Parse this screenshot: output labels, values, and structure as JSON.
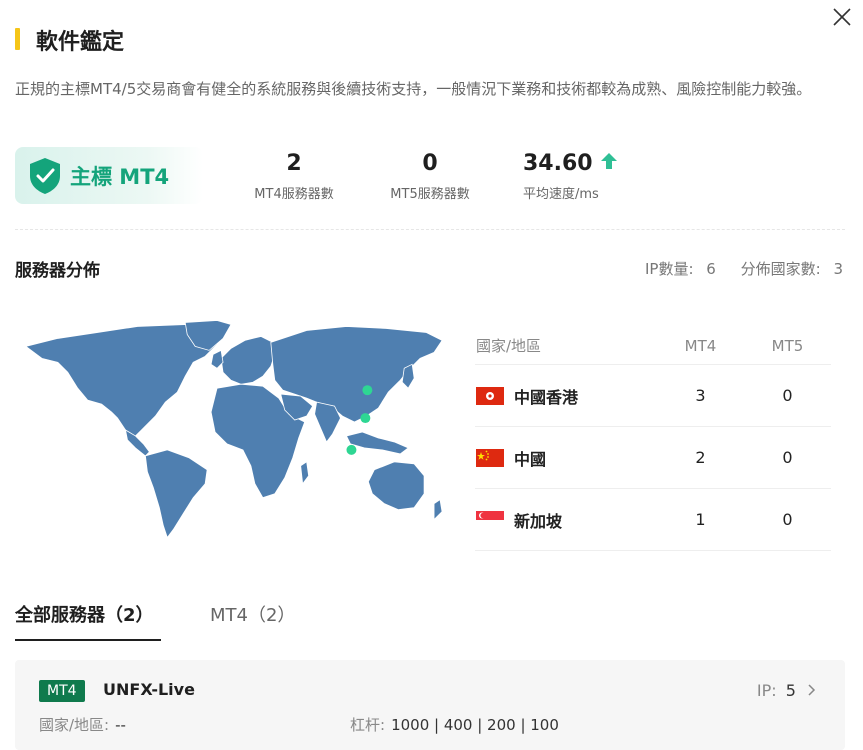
{
  "header": {
    "title": "軟件鑑定"
  },
  "description": "正規的主標MT4/5交易商會有健全的系統服務與後續技術支持，一般情況下業務和技術都較為成熟、風險控制能力較強。",
  "badge": {
    "label": "主標 MT4"
  },
  "stats": [
    {
      "value": "2",
      "label": "MT4服務器數"
    },
    {
      "value": "0",
      "label": "MT5服務器數"
    },
    {
      "value": "34.60",
      "label": "平均速度/ms"
    }
  ],
  "distribution": {
    "title": "服務器分佈",
    "ip_label": "IP數量:",
    "ip_count": "6",
    "country_label": "分佈國家數:",
    "country_count": "3",
    "table": {
      "headers": [
        "國家/地區",
        "MT4",
        "MT5"
      ],
      "rows": [
        {
          "country": "中國香港",
          "mt4": "3",
          "mt5": "0"
        },
        {
          "country": "中國",
          "mt4": "2",
          "mt5": "0"
        },
        {
          "country": "新加坡",
          "mt4": "1",
          "mt5": "0"
        }
      ]
    },
    "colors": {
      "map": "#4f7fb0",
      "marker": "#2ed693"
    }
  },
  "tabs": [
    {
      "label": "全部服務器（2）",
      "active": true
    },
    {
      "label": "MT4（2）",
      "active": false
    }
  ],
  "server_card": {
    "tag": "MT4",
    "name": "UNFX-Live",
    "ip_label": "IP:",
    "ip_count": "5",
    "country_label": "國家/地區:",
    "country_value": "--",
    "leverage_label": "杠杆:",
    "leverage_value": "1000 | 400 | 200 | 100"
  },
  "icons": {
    "close": "close-icon",
    "shield": "shield-check-icon",
    "trend": "arrow-up-icon",
    "chevron": "chevron-right-icon"
  },
  "accent_color": "#14a47b"
}
